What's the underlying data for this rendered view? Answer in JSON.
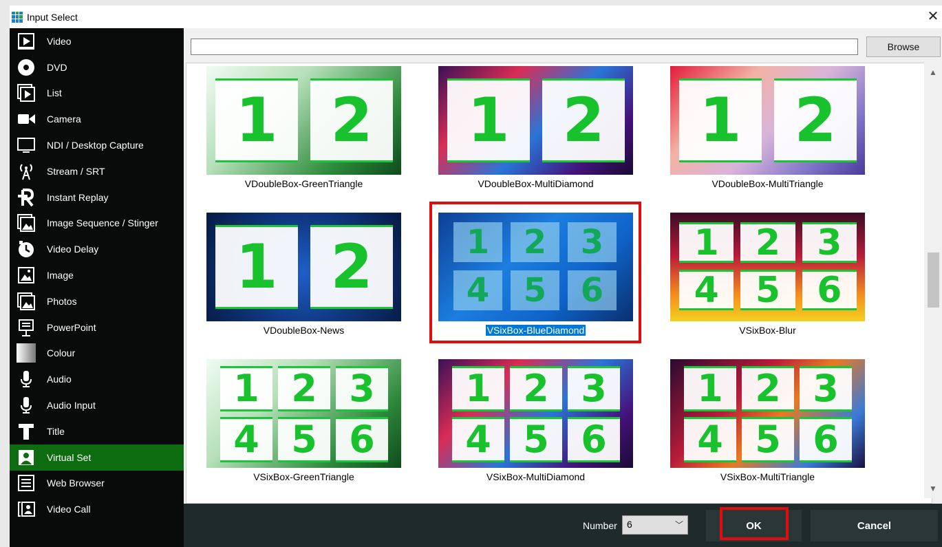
{
  "window": {
    "title": "Input Select"
  },
  "sidebar": {
    "items": [
      {
        "label": "Video",
        "icon": "video-icon"
      },
      {
        "label": "DVD",
        "icon": "dvd-icon"
      },
      {
        "label": "List",
        "icon": "list-icon"
      },
      {
        "label": "Camera",
        "icon": "camera-icon"
      },
      {
        "label": "NDI / Desktop Capture",
        "icon": "desktop-icon"
      },
      {
        "label": "Stream / SRT",
        "icon": "stream-icon"
      },
      {
        "label": "Instant Replay",
        "icon": "replay-icon"
      },
      {
        "label": "Image Sequence / Stinger",
        "icon": "image-sequence-icon"
      },
      {
        "label": "Video Delay",
        "icon": "video-delay-icon"
      },
      {
        "label": "Image",
        "icon": "image-icon"
      },
      {
        "label": "Photos",
        "icon": "photos-icon"
      },
      {
        "label": "PowerPoint",
        "icon": "powerpoint-icon"
      },
      {
        "label": "Colour",
        "icon": "colour-icon"
      },
      {
        "label": "Audio",
        "icon": "audio-icon"
      },
      {
        "label": "Audio Input",
        "icon": "audio-input-icon"
      },
      {
        "label": "Title",
        "icon": "title-icon"
      },
      {
        "label": "Virtual Set",
        "icon": "virtual-set-icon",
        "active": true
      },
      {
        "label": "Web Browser",
        "icon": "web-browser-icon"
      },
      {
        "label": "Video Call",
        "icon": "video-call-icon"
      }
    ]
  },
  "path": {
    "value": ""
  },
  "browse_label": "Browse",
  "tiles": [
    {
      "label": "VDoubleBox-GreenTriangle",
      "numbers": [
        "1",
        "2"
      ]
    },
    {
      "label": "VDoubleBox-MultiDiamond",
      "numbers": [
        "1",
        "2"
      ]
    },
    {
      "label": "VDoubleBox-MultiTriangle",
      "numbers": [
        "1",
        "2"
      ]
    },
    {
      "label": "VDoubleBox-News",
      "numbers": [
        "1",
        "2"
      ]
    },
    {
      "label": "VSixBox-BlueDiamond",
      "numbers": [
        "1",
        "2",
        "3",
        "4",
        "5",
        "6"
      ],
      "selected": true
    },
    {
      "label": "VSixBox-Blur",
      "numbers": [
        "1",
        "2",
        "3",
        "4",
        "5",
        "6"
      ]
    },
    {
      "label": "VSixBox-GreenTriangle",
      "numbers": [
        "1",
        "2",
        "3",
        "4",
        "5",
        "6"
      ]
    },
    {
      "label": "VSixBox-MultiDiamond",
      "numbers": [
        "1",
        "2",
        "3",
        "4",
        "5",
        "6"
      ]
    },
    {
      "label": "VSixBox-MultiTriangle",
      "numbers": [
        "1",
        "2",
        "3",
        "4",
        "5",
        "6"
      ]
    }
  ],
  "footer": {
    "number_label": "Number",
    "number_value": "6",
    "ok_label": "OK",
    "cancel_label": "Cancel"
  },
  "colors": {
    "active_item": "#0d6b10",
    "sidebar_bg": "#090b0a",
    "footer_bg": "#1f2a2a",
    "highlight": "#e10c0c",
    "selection": "#0078d7"
  }
}
